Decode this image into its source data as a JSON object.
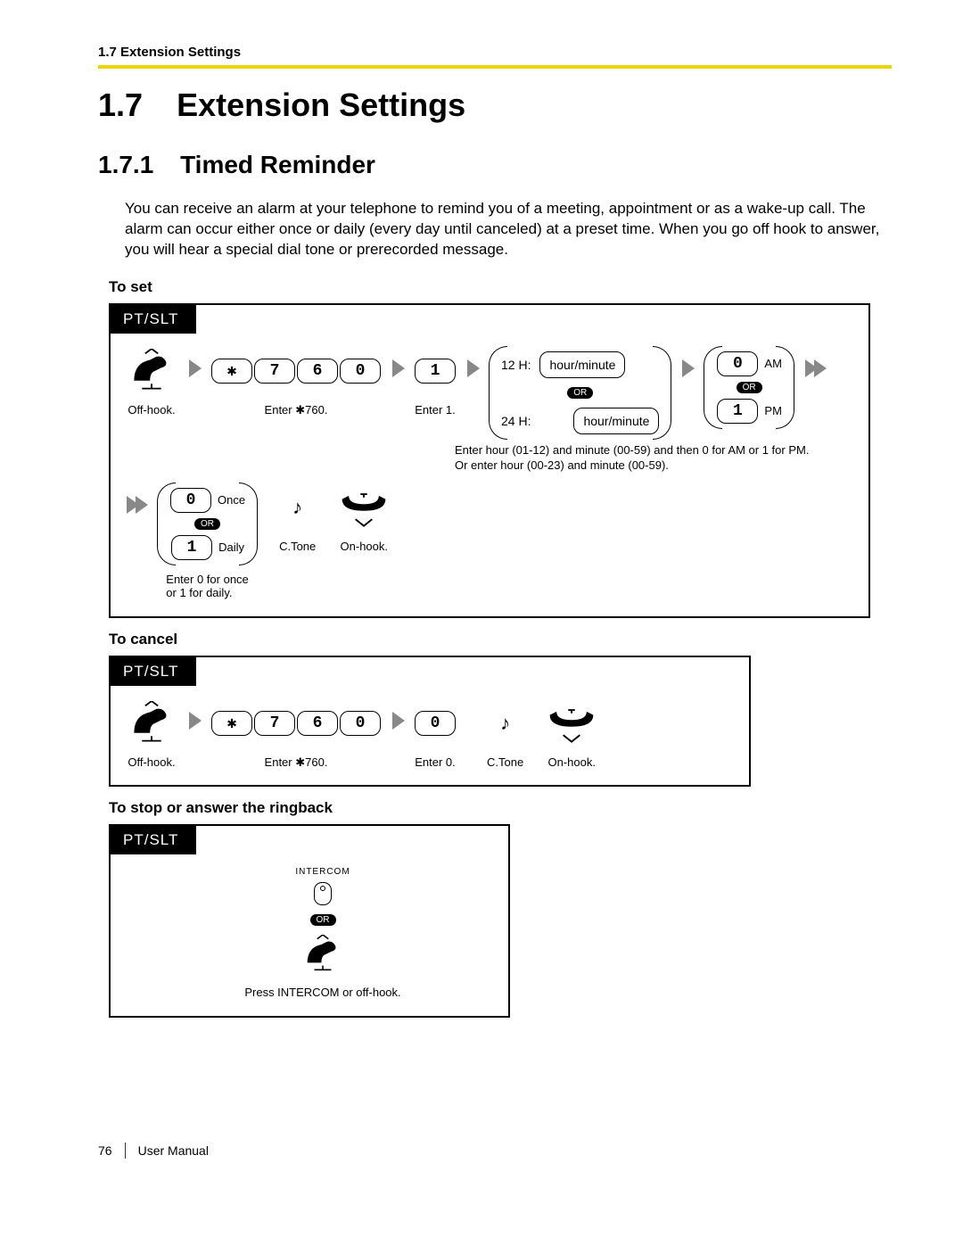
{
  "header": {
    "running": "1.7 Extension Settings"
  },
  "section": {
    "number": "1.7",
    "title": "Extension Settings"
  },
  "subsection": {
    "number": "1.7.1",
    "title": "Timed Reminder"
  },
  "intro": "You can receive an alarm at your telephone to remind you of a meeting, appointment or as a wake-up call. The alarm can occur either once or daily (every day until canceled) at a preset time. When you go off hook to answer, you will hear a special dial tone or prerecorded message.",
  "to_set": {
    "heading": "To set",
    "tab": "PT/SLT",
    "step_offhook": "Off-hook.",
    "keys_760": [
      "✱",
      "7",
      "6",
      "0"
    ],
    "step_enter760": "Enter ✱760.",
    "key_1": "1",
    "step_enter1": "Enter 1.",
    "label_12h": "12 H:",
    "label_24h": "24 H:",
    "hm_field": "hour/minute",
    "or": "OR",
    "ampm": {
      "am_key": "0",
      "am": "AM",
      "pm_key": "1",
      "pm": "PM"
    },
    "hm_note_1": "Enter hour (01-12) and minute (00-59) and then 0 for AM or 1 for PM.",
    "hm_note_2": "Or enter hour (00-23) and minute (00-59).",
    "once_key": "0",
    "once": "Once",
    "daily_key": "1",
    "daily": "Daily",
    "once_daily_note": "Enter 0 for once\nor 1 for daily.",
    "ctone": "C.Tone",
    "onhook": "On-hook."
  },
  "to_cancel": {
    "heading": "To cancel",
    "tab": "PT/SLT",
    "step_offhook": "Off-hook.",
    "keys_760": [
      "✱",
      "7",
      "6",
      "0"
    ],
    "step_enter760": "Enter ✱760.",
    "key_0": "0",
    "step_enter0": "Enter 0.",
    "ctone": "C.Tone",
    "onhook": "On-hook."
  },
  "to_stop": {
    "heading": "To stop or answer the ringback",
    "tab": "PT/SLT",
    "intercom": "INTERCOM",
    "or": "OR",
    "caption": "Press INTERCOM or off-hook."
  },
  "footer": {
    "page": "76",
    "label": "User Manual"
  }
}
